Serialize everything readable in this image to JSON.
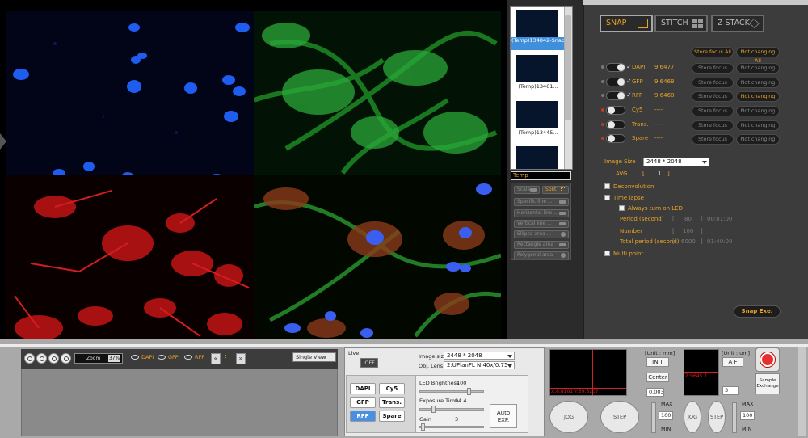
{
  "thumbnails": [
    {
      "label": "(Temp)134842-Snap",
      "selected": true
    },
    {
      "label": "(Temp)13461...",
      "selected": false
    },
    {
      "label": "(Temp)13445...",
      "selected": false
    },
    {
      "label": "",
      "selected": false
    }
  ],
  "folder": "Temp",
  "tools": {
    "scale": "Scale",
    "split": "Split",
    "specific_line": "Specific line ...",
    "horizontal_line": "Horizontal line ...",
    "vertical_line": "Vertical line ...",
    "ellipse_area": "Ellipse area ...",
    "rectangle_area": "Rectangle area",
    "polygonal_area": "Polygonal area"
  },
  "modes": {
    "snap": "SNAP",
    "stitch": "STITCH",
    "zstack": "Z STACK"
  },
  "focus_all": {
    "store": "Store focus All",
    "notchanging": "Not changing All"
  },
  "channels": [
    {
      "name": "DAPI",
      "value": "9.6477",
      "store": "Store focus",
      "change": "Not changing",
      "enabled": true
    },
    {
      "name": "GFP",
      "value": "9.6468",
      "store": "Store focus",
      "change": "Not changing",
      "enabled": true
    },
    {
      "name": "RFP",
      "value": "9.6468",
      "store": "Store focus",
      "change": "Not changing",
      "enabled": true
    },
    {
      "name": "Cy5",
      "value": "----",
      "store": "Store focus",
      "change": "Not changing",
      "enabled": false
    },
    {
      "name": "Trans.",
      "value": "----",
      "store": "Store focus",
      "change": "Not changing",
      "enabled": false
    },
    {
      "name": "Spare",
      "value": "----",
      "store": "Store focus",
      "change": "Not changing",
      "enabled": false
    }
  ],
  "image_size": {
    "label": "Image Size",
    "value": "2448 * 2048"
  },
  "avg": {
    "label": "AVG",
    "bracket_l": "[",
    "value": "1",
    "bracket_r": "]"
  },
  "options": {
    "deconvolution": "Deconvolution",
    "time_lapse": "Time lapse",
    "always_led": "Always turn on LED",
    "period": "Period (second)",
    "period_val": "80",
    "period_time": "00:01:00",
    "number": "Number",
    "number_val": "100",
    "total_period": "Total period (second)",
    "total_val": "6000",
    "total_time": "01:40:00",
    "multi_point": "Multi point",
    "bracket_l": "[",
    "bracket_r": "]"
  },
  "snap_exe": "Snap Exe.",
  "viewer_toolbar": {
    "zoom_label": "Zoom",
    "zoom_value": "37%",
    "eye_labels": [
      "DAPI",
      "GFP",
      "RFP"
    ],
    "prev": "«",
    "mid_sep": ":",
    "next": "»",
    "single_view": "Single View"
  },
  "live": {
    "label": "Live",
    "state": "OFF"
  },
  "acq": {
    "image_size_label": "Image size",
    "image_size_value": "2448 * 2048",
    "lens_label": "Obj. Lens",
    "lens_value": "2:UPlanFL N 40x/0.75",
    "led_label": "LED Brightness",
    "led_value": "100",
    "led_level": 0.78,
    "exp_label": "Exposure Time",
    "exp_value": "94.4",
    "exp_level": 0.2,
    "gain_label": "Gain",
    "gain_value": "3",
    "gain_level": 0.02,
    "auto_exp": "Auto EXP."
  },
  "channel_buttons": [
    {
      "label": "DAPI",
      "active": false
    },
    {
      "label": "Cy5",
      "active": false
    },
    {
      "label": "GFP",
      "active": false
    },
    {
      "label": "Trans.",
      "active": false
    },
    {
      "label": "RFP",
      "active": true
    },
    {
      "label": "Spare",
      "active": false
    }
  ],
  "xy_stage": {
    "unit": "[Unit : mm]",
    "coords": "X:8.8101 Y:59.3207",
    "init": "INIT",
    "center": "Center",
    "step_value": "0.003",
    "jog": "JOG",
    "step": "STEP",
    "max": "MAX",
    "min": "MIN",
    "speed": "100"
  },
  "z_stage": {
    "unit": "[Unit : um]",
    "coord": "Z:9645.7",
    "af": "A F",
    "step_value": "3",
    "jog": "JOG",
    "step": "STEP",
    "max": "MAX",
    "min": "MIN",
    "speed": "100"
  },
  "sample_exchange": "Sample Exchange"
}
